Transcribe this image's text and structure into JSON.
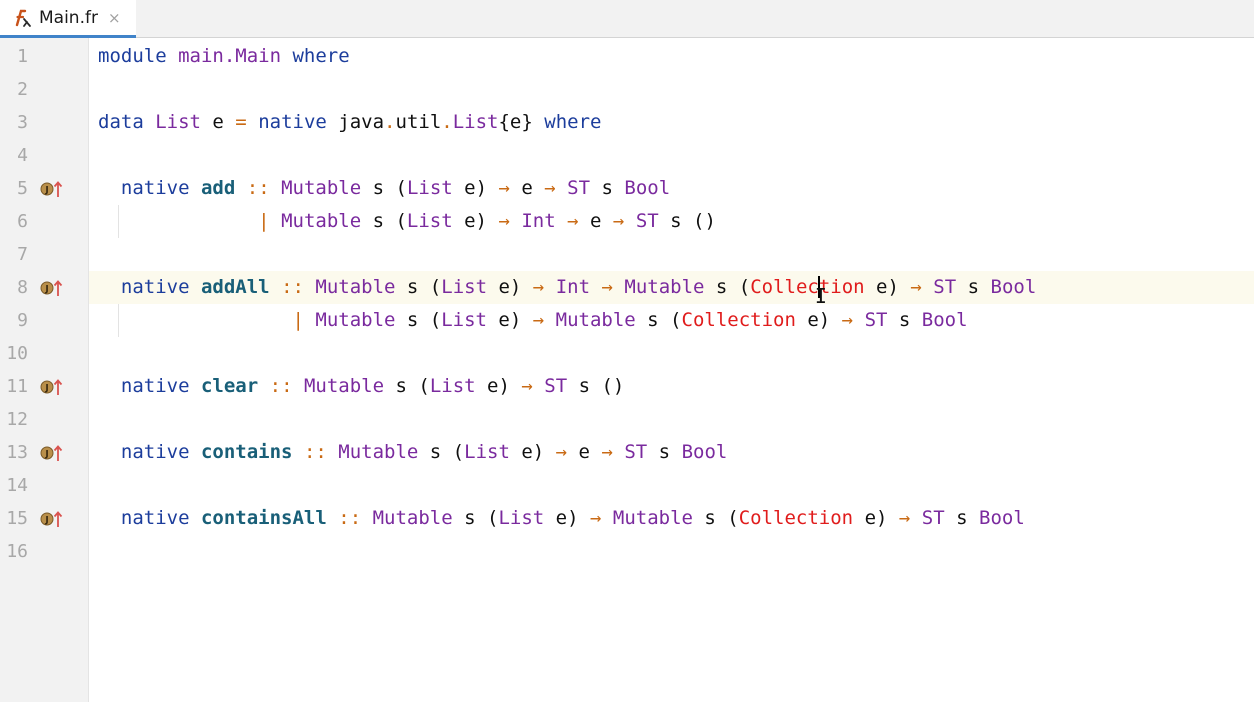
{
  "tab": {
    "title": "Main.fr",
    "close_glyph": "×",
    "icon": "frege-file-icon"
  },
  "gutter": {
    "line_numbers": [
      "1",
      "2",
      "3",
      "4",
      "5",
      "6",
      "7",
      "8",
      "9",
      "10",
      "11",
      "12",
      "13",
      "14",
      "15",
      "16"
    ],
    "icon": "java-implementation-icon"
  },
  "code": {
    "lines": [
      [
        {
          "c": "kw",
          "t": "module "
        },
        {
          "c": "ty",
          "t": "main.Main"
        },
        {
          "c": "",
          "t": " "
        },
        {
          "c": "kw",
          "t": "where"
        }
      ],
      [],
      [
        {
          "c": "kw",
          "t": "data "
        },
        {
          "c": "ty",
          "t": "List"
        },
        {
          "c": "",
          "t": " e "
        },
        {
          "c": "op",
          "t": "="
        },
        {
          "c": "",
          "t": " "
        },
        {
          "c": "kw",
          "t": "native"
        },
        {
          "c": "",
          "t": " java"
        },
        {
          "c": "op",
          "t": "."
        },
        {
          "c": "",
          "t": "util"
        },
        {
          "c": "op",
          "t": "."
        },
        {
          "c": "ty",
          "t": "List"
        },
        {
          "c": "",
          "t": "{e} "
        },
        {
          "c": "kw",
          "t": "where"
        }
      ],
      [],
      [
        {
          "c": "",
          "t": "  "
        },
        {
          "c": "kw",
          "t": "native "
        },
        {
          "c": "fn",
          "t": "add"
        },
        {
          "c": "",
          "t": " "
        },
        {
          "c": "op",
          "t": "::"
        },
        {
          "c": "",
          "t": " "
        },
        {
          "c": "ty",
          "t": "Mutable"
        },
        {
          "c": "",
          "t": " s ("
        },
        {
          "c": "ty",
          "t": "List"
        },
        {
          "c": "",
          "t": " e) "
        },
        {
          "c": "op",
          "t": "→"
        },
        {
          "c": "",
          "t": " e "
        },
        {
          "c": "op",
          "t": "→"
        },
        {
          "c": "",
          "t": " "
        },
        {
          "c": "ty",
          "t": "ST"
        },
        {
          "c": "",
          "t": " s "
        },
        {
          "c": "ty",
          "t": "Bool"
        }
      ],
      [
        {
          "c": "",
          "t": "              "
        },
        {
          "c": "op",
          "t": "|"
        },
        {
          "c": "",
          "t": " "
        },
        {
          "c": "ty",
          "t": "Mutable"
        },
        {
          "c": "",
          "t": " s ("
        },
        {
          "c": "ty",
          "t": "List"
        },
        {
          "c": "",
          "t": " e) "
        },
        {
          "c": "op",
          "t": "→"
        },
        {
          "c": "",
          "t": " "
        },
        {
          "c": "ty",
          "t": "Int"
        },
        {
          "c": "",
          "t": " "
        },
        {
          "c": "op",
          "t": "→"
        },
        {
          "c": "",
          "t": " e "
        },
        {
          "c": "op",
          "t": "→"
        },
        {
          "c": "",
          "t": " "
        },
        {
          "c": "ty",
          "t": "ST"
        },
        {
          "c": "",
          "t": " s ()"
        }
      ],
      [],
      [
        {
          "c": "",
          "t": "  "
        },
        {
          "c": "kw",
          "t": "native "
        },
        {
          "c": "fn",
          "t": "addAll"
        },
        {
          "c": "",
          "t": " "
        },
        {
          "c": "op",
          "t": "::"
        },
        {
          "c": "",
          "t": " "
        },
        {
          "c": "ty",
          "t": "Mutable"
        },
        {
          "c": "",
          "t": " s ("
        },
        {
          "c": "ty",
          "t": "List"
        },
        {
          "c": "",
          "t": " e) "
        },
        {
          "c": "op",
          "t": "→"
        },
        {
          "c": "",
          "t": " "
        },
        {
          "c": "ty",
          "t": "Int"
        },
        {
          "c": "",
          "t": " "
        },
        {
          "c": "op",
          "t": "→"
        },
        {
          "c": "",
          "t": " "
        },
        {
          "c": "ty",
          "t": "Mutable"
        },
        {
          "c": "",
          "t": " s ("
        },
        {
          "c": "er",
          "t": "Collection"
        },
        {
          "c": "",
          "t": " e) "
        },
        {
          "c": "op",
          "t": "→"
        },
        {
          "c": "",
          "t": " "
        },
        {
          "c": "ty",
          "t": "ST"
        },
        {
          "c": "",
          "t": " s "
        },
        {
          "c": "ty",
          "t": "Bool"
        }
      ],
      [
        {
          "c": "",
          "t": "                 "
        },
        {
          "c": "op",
          "t": "|"
        },
        {
          "c": "",
          "t": " "
        },
        {
          "c": "ty",
          "t": "Mutable"
        },
        {
          "c": "",
          "t": " s ("
        },
        {
          "c": "ty",
          "t": "List"
        },
        {
          "c": "",
          "t": " e) "
        },
        {
          "c": "op",
          "t": "→"
        },
        {
          "c": "",
          "t": " "
        },
        {
          "c": "ty",
          "t": "Mutable"
        },
        {
          "c": "",
          "t": " s ("
        },
        {
          "c": "er",
          "t": "Collection"
        },
        {
          "c": "",
          "t": " e) "
        },
        {
          "c": "op",
          "t": "→"
        },
        {
          "c": "",
          "t": " "
        },
        {
          "c": "ty",
          "t": "ST"
        },
        {
          "c": "",
          "t": " s "
        },
        {
          "c": "ty",
          "t": "Bool"
        }
      ],
      [],
      [
        {
          "c": "",
          "t": "  "
        },
        {
          "c": "kw",
          "t": "native "
        },
        {
          "c": "fn",
          "t": "clear"
        },
        {
          "c": "",
          "t": " "
        },
        {
          "c": "op",
          "t": "::"
        },
        {
          "c": "",
          "t": " "
        },
        {
          "c": "ty",
          "t": "Mutable"
        },
        {
          "c": "",
          "t": " s ("
        },
        {
          "c": "ty",
          "t": "List"
        },
        {
          "c": "",
          "t": " e) "
        },
        {
          "c": "op",
          "t": "→"
        },
        {
          "c": "",
          "t": " "
        },
        {
          "c": "ty",
          "t": "ST"
        },
        {
          "c": "",
          "t": " s ()"
        }
      ],
      [],
      [
        {
          "c": "",
          "t": "  "
        },
        {
          "c": "kw",
          "t": "native "
        },
        {
          "c": "fn",
          "t": "contains"
        },
        {
          "c": "",
          "t": " "
        },
        {
          "c": "op",
          "t": "::"
        },
        {
          "c": "",
          "t": " "
        },
        {
          "c": "ty",
          "t": "Mutable"
        },
        {
          "c": "",
          "t": " s ("
        },
        {
          "c": "ty",
          "t": "List"
        },
        {
          "c": "",
          "t": " e) "
        },
        {
          "c": "op",
          "t": "→"
        },
        {
          "c": "",
          "t": " e "
        },
        {
          "c": "op",
          "t": "→"
        },
        {
          "c": "",
          "t": " "
        },
        {
          "c": "ty",
          "t": "ST"
        },
        {
          "c": "",
          "t": " s "
        },
        {
          "c": "ty",
          "t": "Bool"
        }
      ],
      [],
      [
        {
          "c": "",
          "t": "  "
        },
        {
          "c": "kw",
          "t": "native "
        },
        {
          "c": "fn",
          "t": "containsAll"
        },
        {
          "c": "",
          "t": " "
        },
        {
          "c": "op",
          "t": "::"
        },
        {
          "c": "",
          "t": " "
        },
        {
          "c": "ty",
          "t": "Mutable"
        },
        {
          "c": "",
          "t": " s ("
        },
        {
          "c": "ty",
          "t": "List"
        },
        {
          "c": "",
          "t": " e) "
        },
        {
          "c": "op",
          "t": "→"
        },
        {
          "c": "",
          "t": " "
        },
        {
          "c": "ty",
          "t": "Mutable"
        },
        {
          "c": "",
          "t": " s ("
        },
        {
          "c": "er",
          "t": "Collection"
        },
        {
          "c": "",
          "t": " e) "
        },
        {
          "c": "op",
          "t": "→"
        },
        {
          "c": "",
          "t": " "
        },
        {
          "c": "ty",
          "t": "ST"
        },
        {
          "c": "",
          "t": " s "
        },
        {
          "c": "ty",
          "t": "Bool"
        }
      ],
      []
    ],
    "gutter_icon_lines": [
      5,
      8,
      11,
      13,
      15
    ],
    "current_line": 8,
    "indent_guide_lines": [
      6,
      9
    ]
  },
  "colors": {
    "keyword": "#1c3d9c",
    "function": "#195f78",
    "type": "#7a2a9e",
    "operator": "#c96a14",
    "unresolved": "#e01c1c",
    "caret_line": "#fcfaed"
  }
}
